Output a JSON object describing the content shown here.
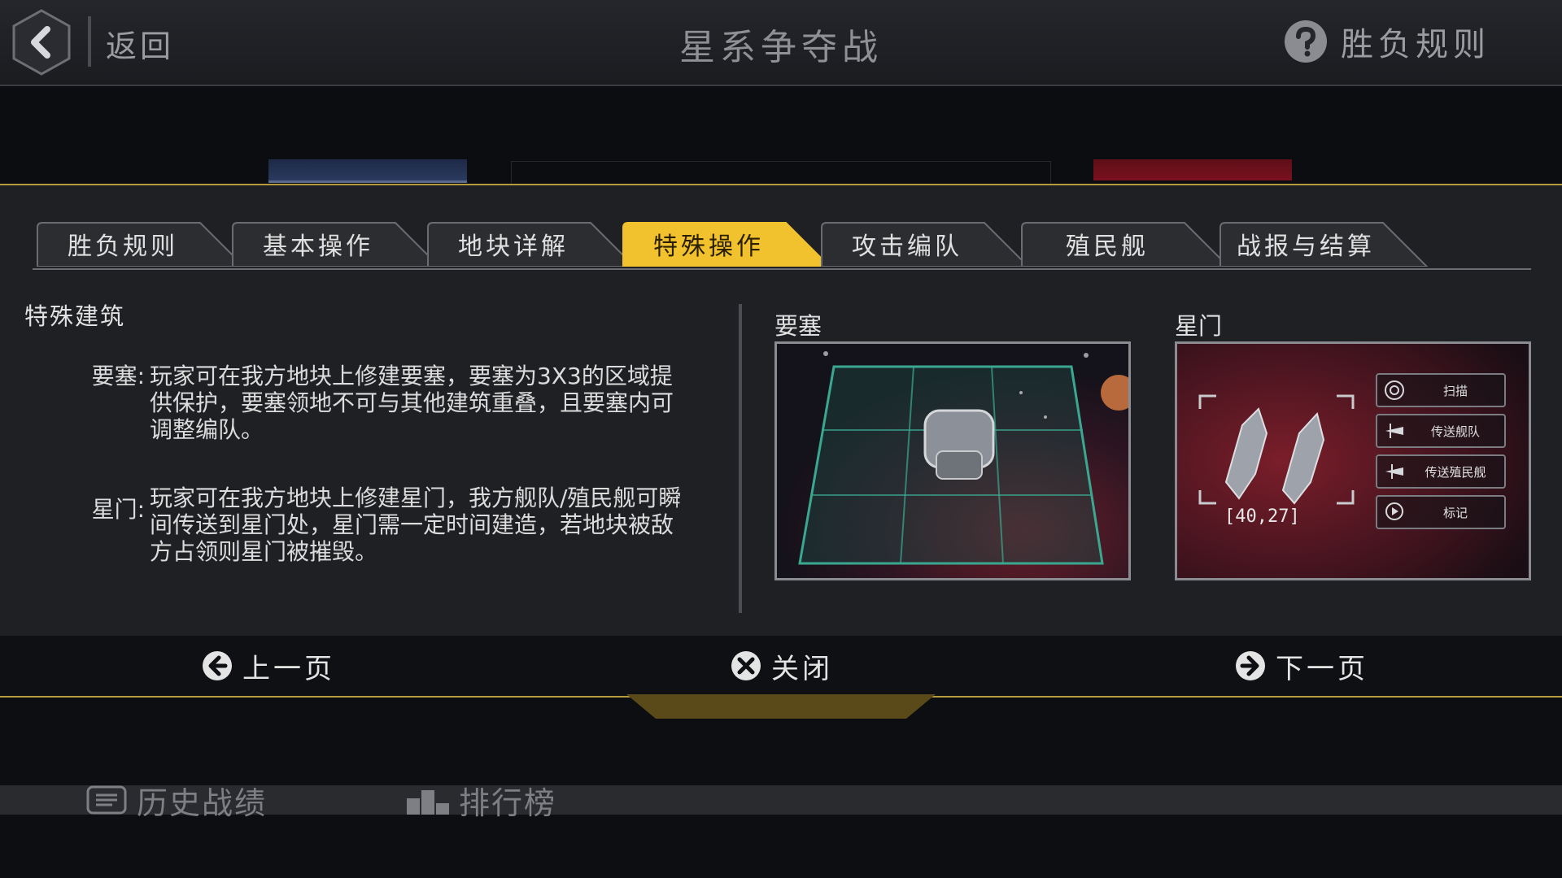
{
  "header": {
    "back_label": "返回",
    "title": "星系争夺战",
    "rules_label": "胜负规则"
  },
  "tabs": [
    {
      "label": "胜负规则",
      "active": false
    },
    {
      "label": "基本操作",
      "active": false
    },
    {
      "label": "地块详解",
      "active": false
    },
    {
      "label": "特殊操作",
      "active": true
    },
    {
      "label": "攻击编队",
      "active": false
    },
    {
      "label": "殖民舰",
      "active": false
    },
    {
      "label": "战报与结算",
      "active": false
    }
  ],
  "content": {
    "section_title": "特殊建筑",
    "items": [
      {
        "label": "要塞:",
        "text": "玩家可在我方地块上修建要塞，要塞为3X3的区域提供保护，要塞领地不可与其他建筑重叠，且要塞内可调整编队。"
      },
      {
        "label": "星门:",
        "text": "玩家可在我方地块上修建星门，我方舰队/殖民舰可瞬间传送到星门处，星门需一定时间建造，若地块被敌方占领则星门被摧毁。"
      }
    ],
    "images": [
      {
        "label": "要塞"
      },
      {
        "label": "星门",
        "coords": "[40,27]",
        "menu": [
          "扫描",
          "传送舰队",
          "传送殖民舰",
          "标记"
        ]
      }
    ]
  },
  "nav": {
    "prev_label": "上一页",
    "close_label": "关闭",
    "next_label": "下一页"
  },
  "bottom": {
    "history_label": "历史战绩",
    "ranking_label": "排行榜"
  },
  "colors": {
    "accent_gold": "#f2c12e",
    "panel_border": "#b59a3e",
    "team_blue": "#2a3a5e",
    "team_red": "#7a1020"
  },
  "icons": [
    "back-chevron-icon",
    "question-icon",
    "arrow-left-icon",
    "close-x-icon",
    "arrow-right-icon",
    "history-icon",
    "ranking-icon",
    "scan-icon",
    "fleet-icon",
    "colony-ship-icon",
    "marker-icon"
  ]
}
